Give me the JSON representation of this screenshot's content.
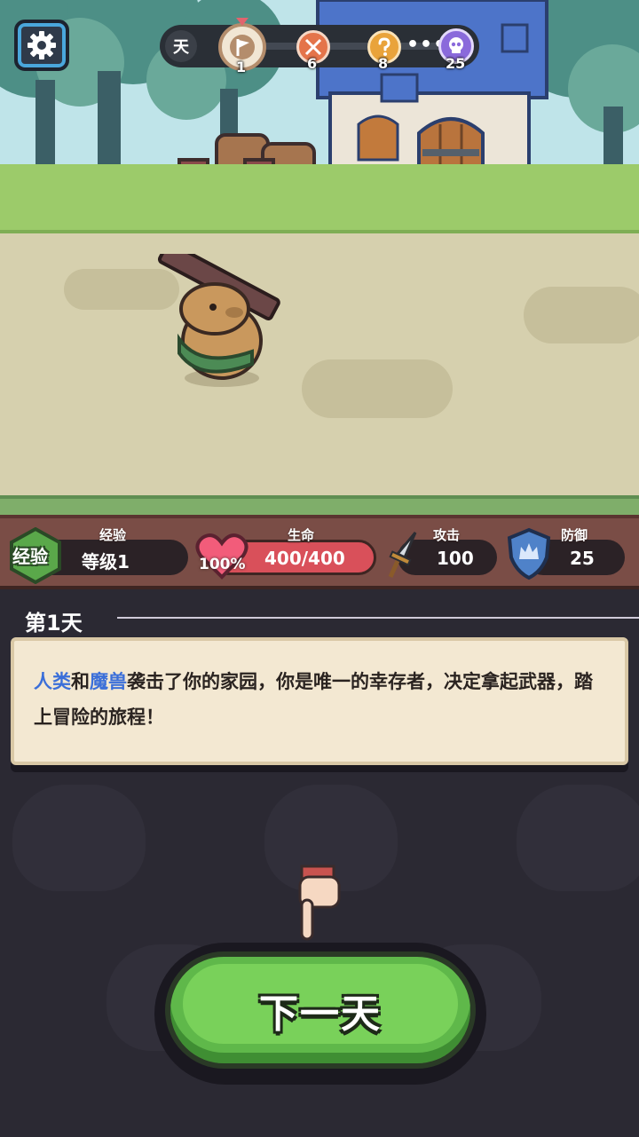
{
  "top_bar": {
    "day_label": "天",
    "nodes": [
      {
        "icon": "flag-icon",
        "value": "1",
        "color": "#b48d6c"
      },
      {
        "icon": "crossed-swords-icon",
        "value": "6",
        "color": "#e4744a"
      },
      {
        "icon": "question-icon",
        "value": "8",
        "color": "#e9a33b"
      },
      {
        "icon": "skull-icon",
        "value": "25",
        "color": "#8a6adb"
      }
    ],
    "ellipsis": "•••"
  },
  "stats": {
    "exp": {
      "badge": "经验",
      "title": "经验",
      "level": "等级1"
    },
    "health": {
      "title": "生命",
      "percent_label": "100%",
      "value": "400/400",
      "fill_fraction": 1.0
    },
    "attack": {
      "title": "攻击",
      "value": "100"
    },
    "defense": {
      "title": "防御",
      "value": "25"
    }
  },
  "story": {
    "day_title": "第1天",
    "segments": [
      {
        "text": "人类",
        "highlight": true
      },
      {
        "text": "和",
        "highlight": false
      },
      {
        "text": "魔兽",
        "highlight": true
      },
      {
        "text": "袭击了你的家园，你是唯一的幸存者，决定拿起武器，踏上冒险的旅程！",
        "highlight": false
      }
    ]
  },
  "next_button": {
    "label": "下一天"
  },
  "colors": {
    "highlight": "#3b6fd9",
    "health": "#d9505a",
    "button": "#5fb84a",
    "exp_badge": "#5aa84a"
  }
}
